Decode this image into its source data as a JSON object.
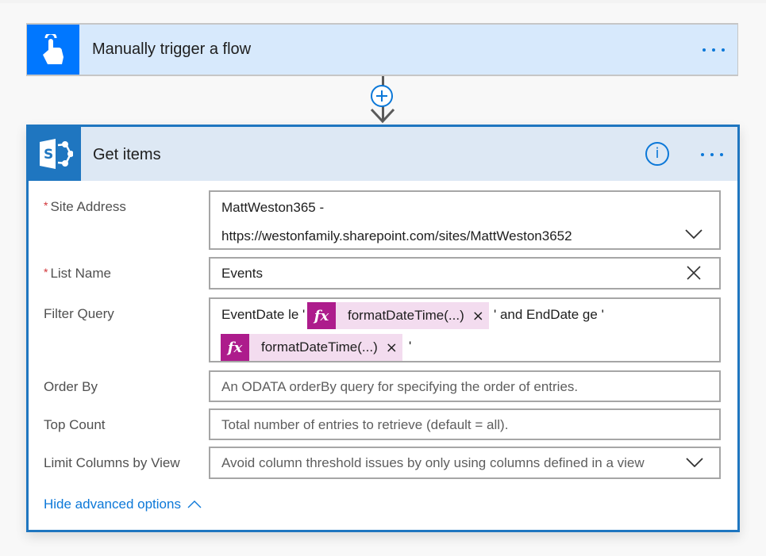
{
  "trigger": {
    "title": "Manually trigger a flow",
    "icon": "touch-hand-icon",
    "accent": "#0077ff"
  },
  "connector": {
    "add_icon": "plus-circle-icon",
    "arrow_icon": "arrow-down-icon"
  },
  "action": {
    "title": "Get items",
    "icon": "sharepoint-icon",
    "accent": "#1f76c0",
    "info_icon": "info-icon",
    "fields": {
      "site_address": {
        "label": "Site Address",
        "required": "*",
        "value_line1": "MattWeston365 -",
        "value_line2": "https://westonfamily.sharepoint.com/sites/MattWeston3652"
      },
      "list_name": {
        "label": "List Name",
        "required": "*",
        "value": "Events"
      },
      "filter_query": {
        "label": "Filter Query",
        "text_before": "EventDate le '",
        "token1": "formatDateTime(...)",
        "text_middle": "' and EndDate ge '",
        "token2": "formatDateTime(...)",
        "text_after": "'",
        "token_icon": "fx",
        "token_close": "×"
      },
      "order_by": {
        "label": "Order By",
        "placeholder": "An ODATA orderBy query for specifying the order of entries."
      },
      "top_count": {
        "label": "Top Count",
        "placeholder": "Total number of entries to retrieve (default = all)."
      },
      "limit_columns": {
        "label": "Limit Columns by View",
        "placeholder": "Avoid column threshold issues by only using columns defined in a view"
      }
    },
    "hide_advanced_label": "Hide advanced options"
  }
}
